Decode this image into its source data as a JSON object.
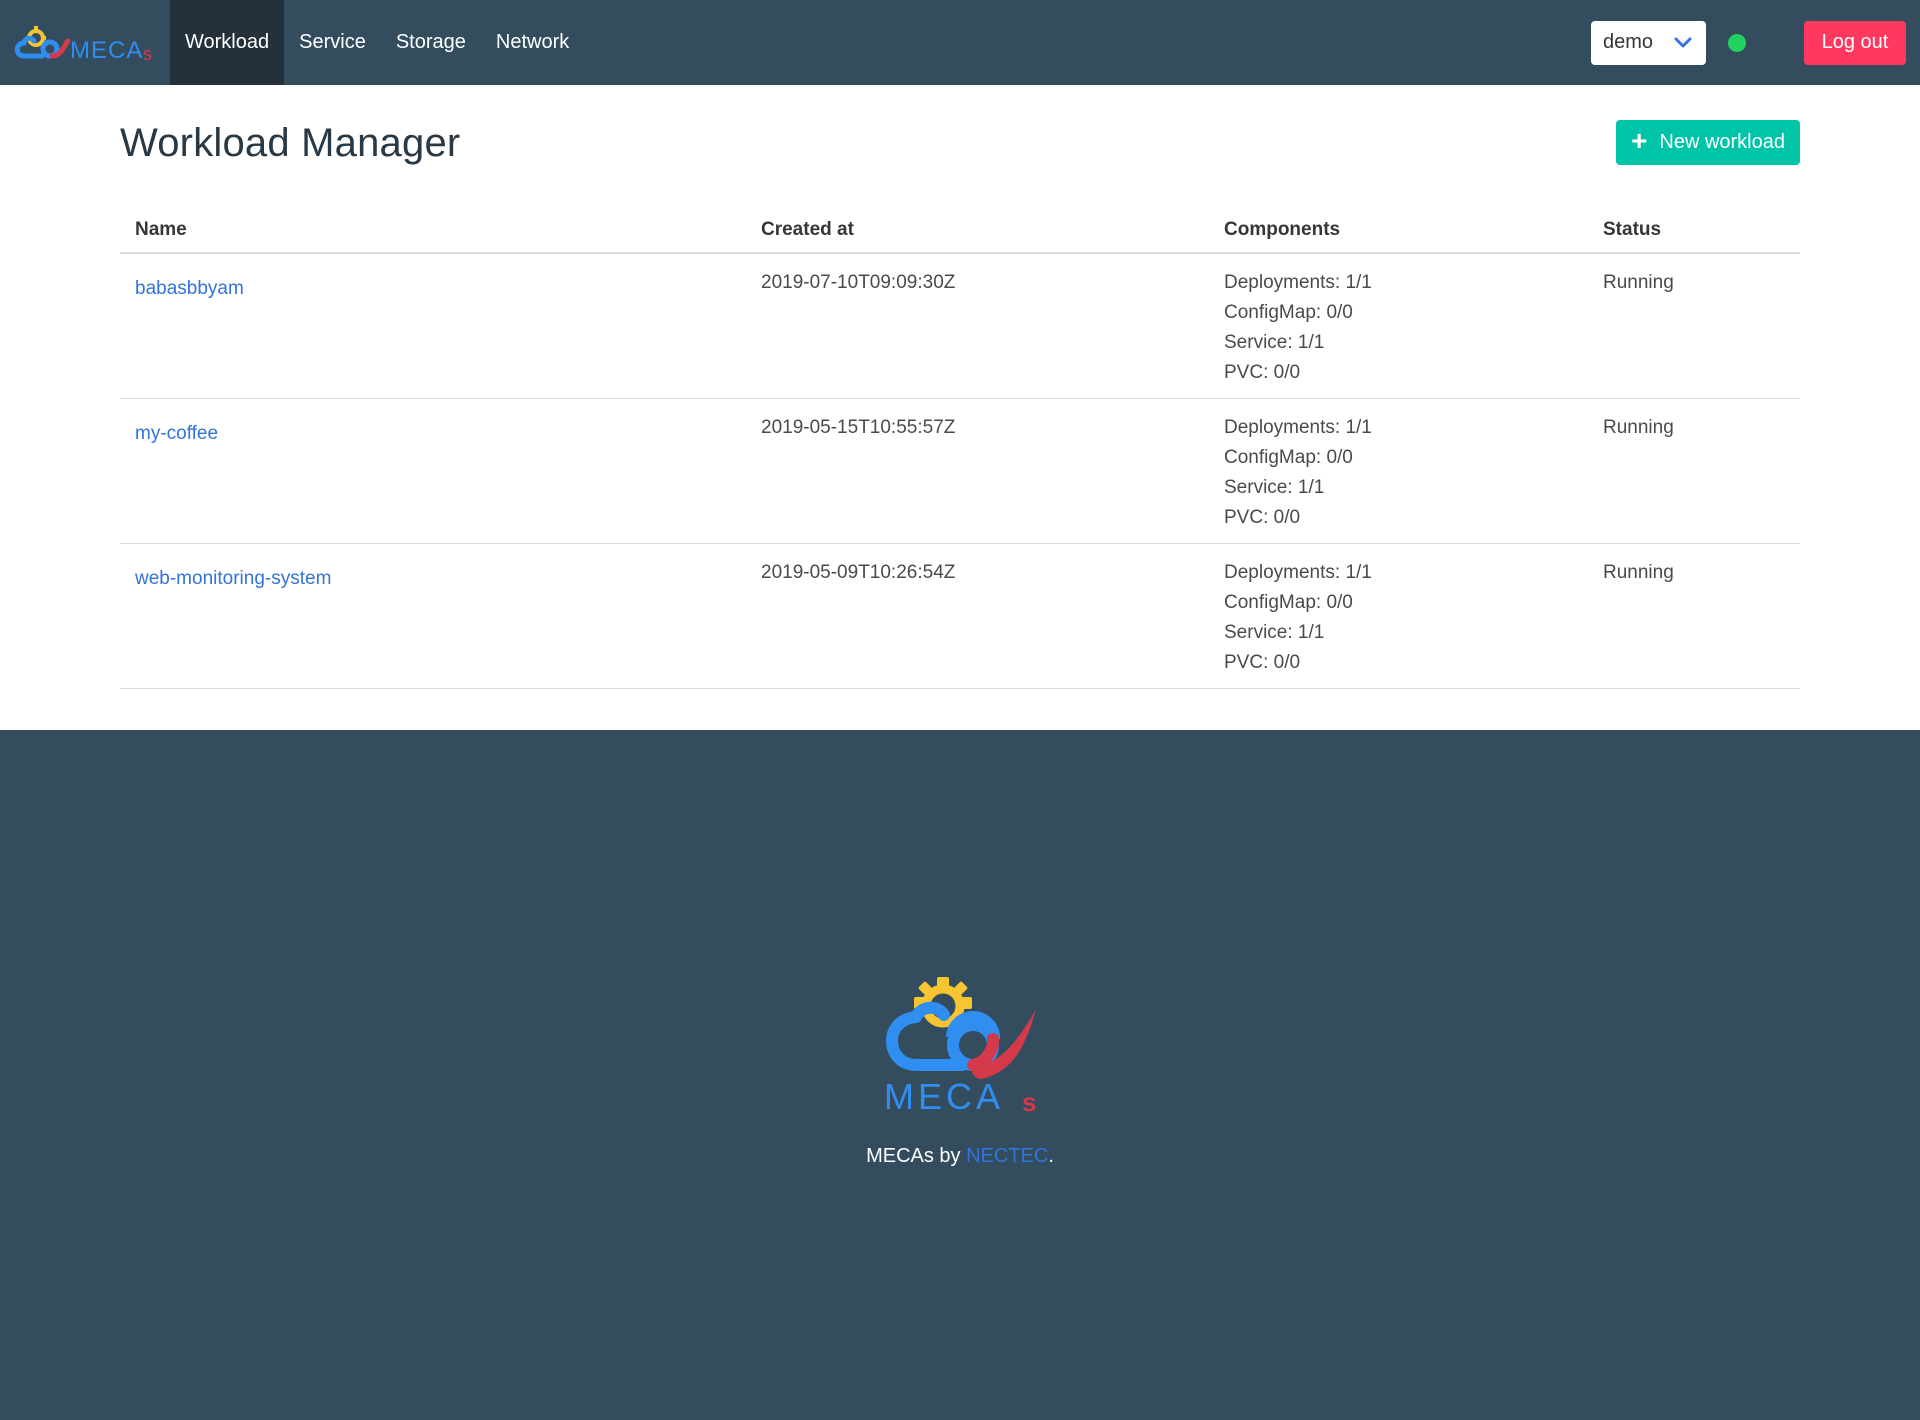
{
  "nav": {
    "brand": "MECAs",
    "items": [
      {
        "label": "Workload",
        "active": true
      },
      {
        "label": "Service",
        "active": false
      },
      {
        "label": "Storage",
        "active": false
      },
      {
        "label": "Network",
        "active": false
      }
    ],
    "namespace": "demo",
    "status_color": "#23d160",
    "logout_label": "Log out"
  },
  "page": {
    "title": "Workload Manager",
    "new_button_label": "New workload"
  },
  "table": {
    "headers": [
      "Name",
      "Created at",
      "Components",
      "Status"
    ],
    "rows": [
      {
        "name": "babasbbyam",
        "created_at": "2019-07-10T09:09:30Z",
        "components": [
          "Deployments: 1/1",
          "ConfigMap: 0/0",
          "Service: 1/1",
          "PVC: 0/0"
        ],
        "status": "Running"
      },
      {
        "name": "my-coffee",
        "created_at": "2019-05-15T10:55:57Z",
        "components": [
          "Deployments: 1/1",
          "ConfigMap: 0/0",
          "Service: 1/1",
          "PVC: 0/0"
        ],
        "status": "Running"
      },
      {
        "name": "web-monitoring-system",
        "created_at": "2019-05-09T10:26:54Z",
        "components": [
          "Deployments: 1/1",
          "ConfigMap: 0/0",
          "Service: 1/1",
          "PVC: 0/0"
        ],
        "status": "Running"
      }
    ]
  },
  "footer": {
    "logo_text": "MECAs",
    "text_before": "MECAs by ",
    "link_text": "NECTEC",
    "text_after": "."
  },
  "colors": {
    "navbar": "#334d5f",
    "primary_button": "#00c4a7",
    "danger_button": "#ff3860",
    "link": "#3273dc"
  }
}
